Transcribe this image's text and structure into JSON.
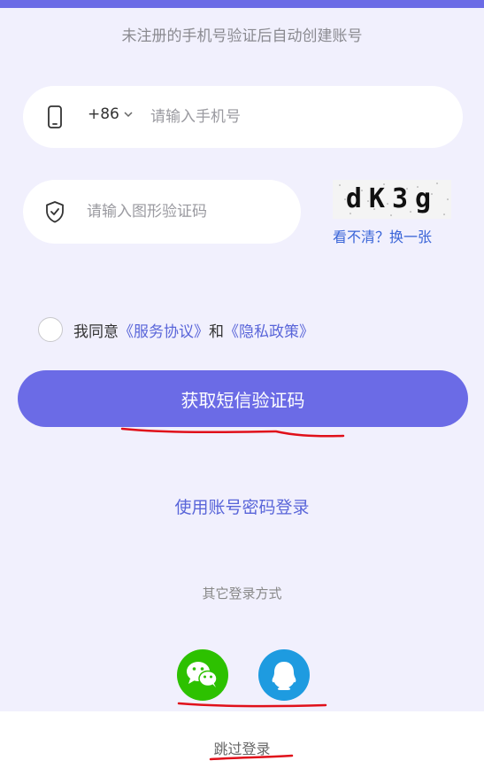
{
  "header": {
    "subtitle": "未注册的手机号验证后自动创建账号"
  },
  "phone": {
    "country_code": "+86",
    "placeholder": "请输入手机号",
    "value": ""
  },
  "captcha": {
    "placeholder": "请输入图形验证码",
    "value": "",
    "image_text": "dK3g",
    "refresh_label": "看不清？换一张"
  },
  "agreement": {
    "prefix": "我同意",
    "terms_link": "《服务协议》",
    "conjunction": "和",
    "privacy_link": "《隐私政策》",
    "checked": false
  },
  "actions": {
    "sms_button": "获取短信验证码",
    "password_login": "使用账号密码登录",
    "other_login_label": "其它登录方式",
    "skip_login": "跳过登录"
  },
  "social": {
    "wechat": "wechat-icon",
    "qq": "qq-icon"
  },
  "colors": {
    "accent": "#6b6be6",
    "link": "#5965d9",
    "background": "#f1f0fd",
    "wechat": "#2dc100",
    "qq": "#1e9be0",
    "annotation": "#e0101a"
  }
}
